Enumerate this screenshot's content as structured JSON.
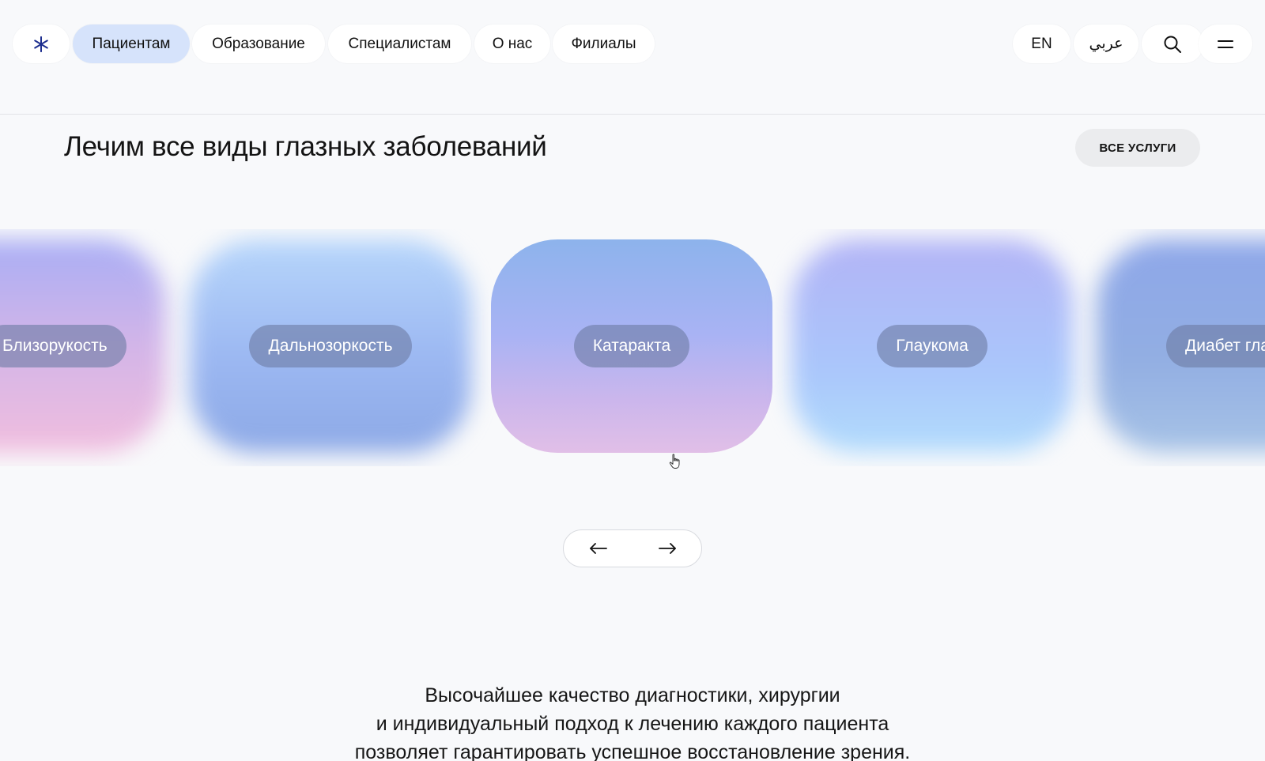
{
  "header": {
    "logo_icon": "asterisk-icon",
    "nav": [
      {
        "label": "Пациентам",
        "active": true
      },
      {
        "label": "Образование",
        "active": false
      },
      {
        "label": "Специалистам",
        "active": false
      },
      {
        "label": "О нас",
        "active": false
      },
      {
        "label": "Филиалы",
        "active": false
      }
    ],
    "lang_en": "EN",
    "lang_ar": "عربي",
    "search_icon": "search-icon",
    "menu_icon": "menu-icon"
  },
  "section": {
    "title": "Лечим все виды глазных заболеваний",
    "all_services": "ВСЕ УСЛУГИ"
  },
  "carousel": {
    "items": [
      {
        "label": "Близорукость"
      },
      {
        "label": "Дальнозоркость"
      },
      {
        "label": "Катаракта"
      },
      {
        "label": "Глаукома"
      },
      {
        "label": "Диабет гла"
      }
    ],
    "prev_icon": "arrow-left-icon",
    "next_icon": "arrow-right-icon"
  },
  "description": {
    "line1": "Высочайшее качество диагностики, хирургии",
    "line2": "и индивидуальный подход к лечению каждого пациента",
    "line3": "позволяет гарантировать успешное восстановление зрения."
  },
  "colors": {
    "background": "#f8f9fb",
    "active_nav": "#d6e3fb",
    "logo_blue": "#1d2e8f"
  }
}
